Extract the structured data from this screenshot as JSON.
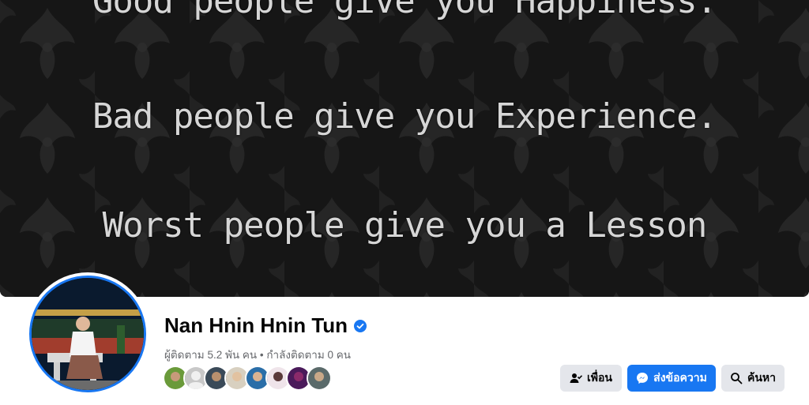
{
  "cover": {
    "quote_lines": [
      "Good people give you Happiness.",
      "Bad people give you Experience.",
      "Worst people give you a Lesson"
    ]
  },
  "profile": {
    "name": "Nan Hnin Hnin Tun",
    "verified": true,
    "stats": "ผู้ติดตาม 5.2 พัน คน • กำลังติดตาม 0 คน",
    "mutual_friend_count_shown": 8
  },
  "actions": {
    "friends_label": "เพื่อน",
    "message_label": "ส่งข้อความ",
    "search_label": "ค้นหา"
  },
  "colors": {
    "accent": "#1877f2",
    "secondary_button": "#e4e6eb",
    "cover_bg": "#141414"
  }
}
